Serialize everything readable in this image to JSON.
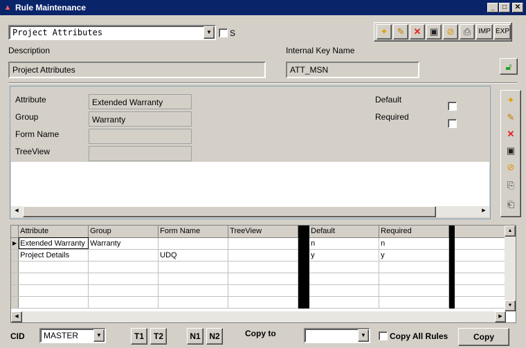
{
  "window": {
    "title": "Rule Maintenance",
    "minimize": "_",
    "maximize": "□",
    "close": "✕"
  },
  "header": {
    "rule_select_value": "Project Attributes",
    "s_checkbox_label": "S",
    "description_label": "Description",
    "description_value": "Project Attributes",
    "internal_key_label": "Internal Key Name",
    "internal_key_value": "ATT_MSN",
    "toolbar": {
      "imp_label": "IMP",
      "exp_label": "EXP"
    }
  },
  "detail": {
    "attribute_label": "Attribute",
    "attribute_value": "Extended Warranty",
    "group_label": "Group",
    "group_value": "Warranty",
    "form_name_label": "Form Name",
    "form_name_value": "",
    "treeview_label": "TreeView",
    "treeview_value": "",
    "default_label": "Default",
    "required_label": "Required"
  },
  "grid": {
    "columns": [
      "Attribute",
      "Group",
      "Form Name",
      "TreeView",
      "Default",
      "Required"
    ],
    "rows": [
      {
        "attribute": "Extended Warranty",
        "group": "Warranty",
        "form_name": "",
        "treeview": "",
        "default": "n",
        "required": "n"
      },
      {
        "attribute": "Project Details",
        "group": "",
        "form_name": "UDQ",
        "treeview": "",
        "default": "y",
        "required": "y"
      }
    ]
  },
  "footer": {
    "cid_label": "CID",
    "cid_value": "MASTER",
    "t1_label": "T1",
    "t2_label": "T2",
    "n1_label": "N1",
    "n2_label": "N2",
    "copy_to_label": "Copy to",
    "copy_to_value": "",
    "copy_all_rules_label": "Copy All Rules",
    "copy_button_label": "Copy"
  },
  "colors": {
    "titlebar": "#0a246a",
    "window_bg": "#d4d0c8"
  }
}
